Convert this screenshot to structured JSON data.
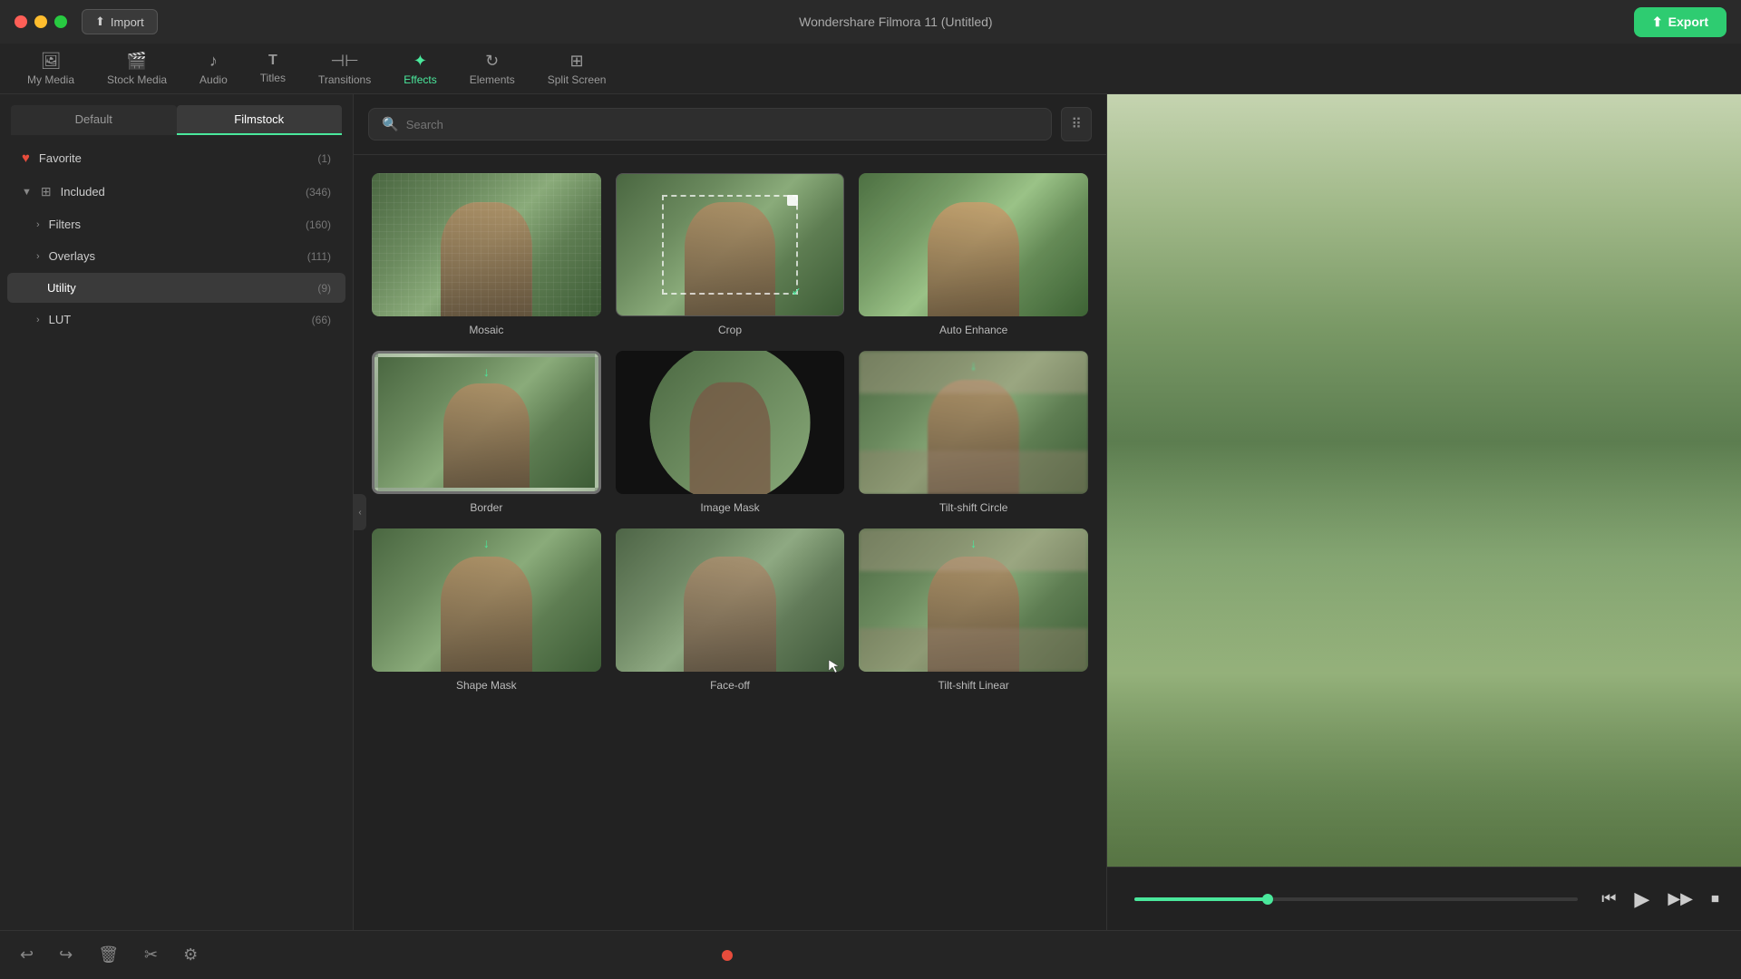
{
  "app": {
    "title": "Wondershare Filmora 11 (Untitled)",
    "import_label": "Import",
    "export_label": "Export"
  },
  "titlebar": {
    "window_controls": [
      "close",
      "minimize",
      "maximize"
    ]
  },
  "nav": {
    "tabs": [
      {
        "id": "my-media",
        "label": "My Media",
        "icon": "🖼"
      },
      {
        "id": "stock-media",
        "label": "Stock Media",
        "icon": "🎬"
      },
      {
        "id": "audio",
        "label": "Audio",
        "icon": "🎵"
      },
      {
        "id": "titles",
        "label": "Titles",
        "icon": "T"
      },
      {
        "id": "transitions",
        "label": "Transitions",
        "icon": "⊣⊢"
      },
      {
        "id": "effects",
        "label": "Effects",
        "icon": "✦",
        "active": true
      },
      {
        "id": "elements",
        "label": "Elements",
        "icon": "↻"
      },
      {
        "id": "split-screen",
        "label": "Split Screen",
        "icon": "⊞"
      }
    ]
  },
  "sidebar": {
    "tabs": [
      {
        "label": "Default",
        "active": false
      },
      {
        "label": "Filmstock",
        "active": true
      }
    ],
    "items": [
      {
        "id": "favorite",
        "label": "Favorite",
        "count": "(1)",
        "icon": "heart",
        "indent": 0
      },
      {
        "id": "included",
        "label": "Included",
        "count": "(346)",
        "icon": "grid",
        "indent": 0,
        "expanded": true
      },
      {
        "id": "filters",
        "label": "Filters",
        "count": "(160)",
        "icon": "chevron",
        "indent": 1
      },
      {
        "id": "overlays",
        "label": "Overlays",
        "count": "(111)",
        "icon": "chevron",
        "indent": 1
      },
      {
        "id": "utility",
        "label": "Utility",
        "count": "(9)",
        "icon": "none",
        "indent": 1,
        "active": true
      },
      {
        "id": "lut",
        "label": "LUT",
        "count": "(66)",
        "icon": "chevron",
        "indent": 1
      }
    ]
  },
  "search": {
    "placeholder": "Search"
  },
  "effects": {
    "items": [
      {
        "id": "mosaic",
        "label": "Mosaic",
        "type": "mosaic"
      },
      {
        "id": "crop",
        "label": "Crop",
        "type": "crop"
      },
      {
        "id": "auto-enhance",
        "label": "Auto Enhance",
        "type": "auto-enhance"
      },
      {
        "id": "border",
        "label": "Border",
        "type": "border",
        "has_download": true
      },
      {
        "id": "image-mask",
        "label": "Image Mask",
        "type": "image-mask"
      },
      {
        "id": "tilt-shift-circle",
        "label": "Tilt-shift Circle",
        "type": "tilt-circle",
        "has_download": true
      },
      {
        "id": "shape-mask",
        "label": "Shape Mask",
        "type": "shape-mask"
      },
      {
        "id": "face-off",
        "label": "Face-off",
        "type": "face-off"
      },
      {
        "id": "tilt-shift-linear",
        "label": "Tilt-shift Linear",
        "type": "tilt-linear",
        "has_download": true
      }
    ]
  },
  "toolbar": {
    "undo_label": "↩",
    "redo_label": "↪",
    "delete_label": "🗑",
    "cut_label": "✂",
    "adjust_label": "⚙"
  },
  "preview": {
    "progress": 30
  }
}
